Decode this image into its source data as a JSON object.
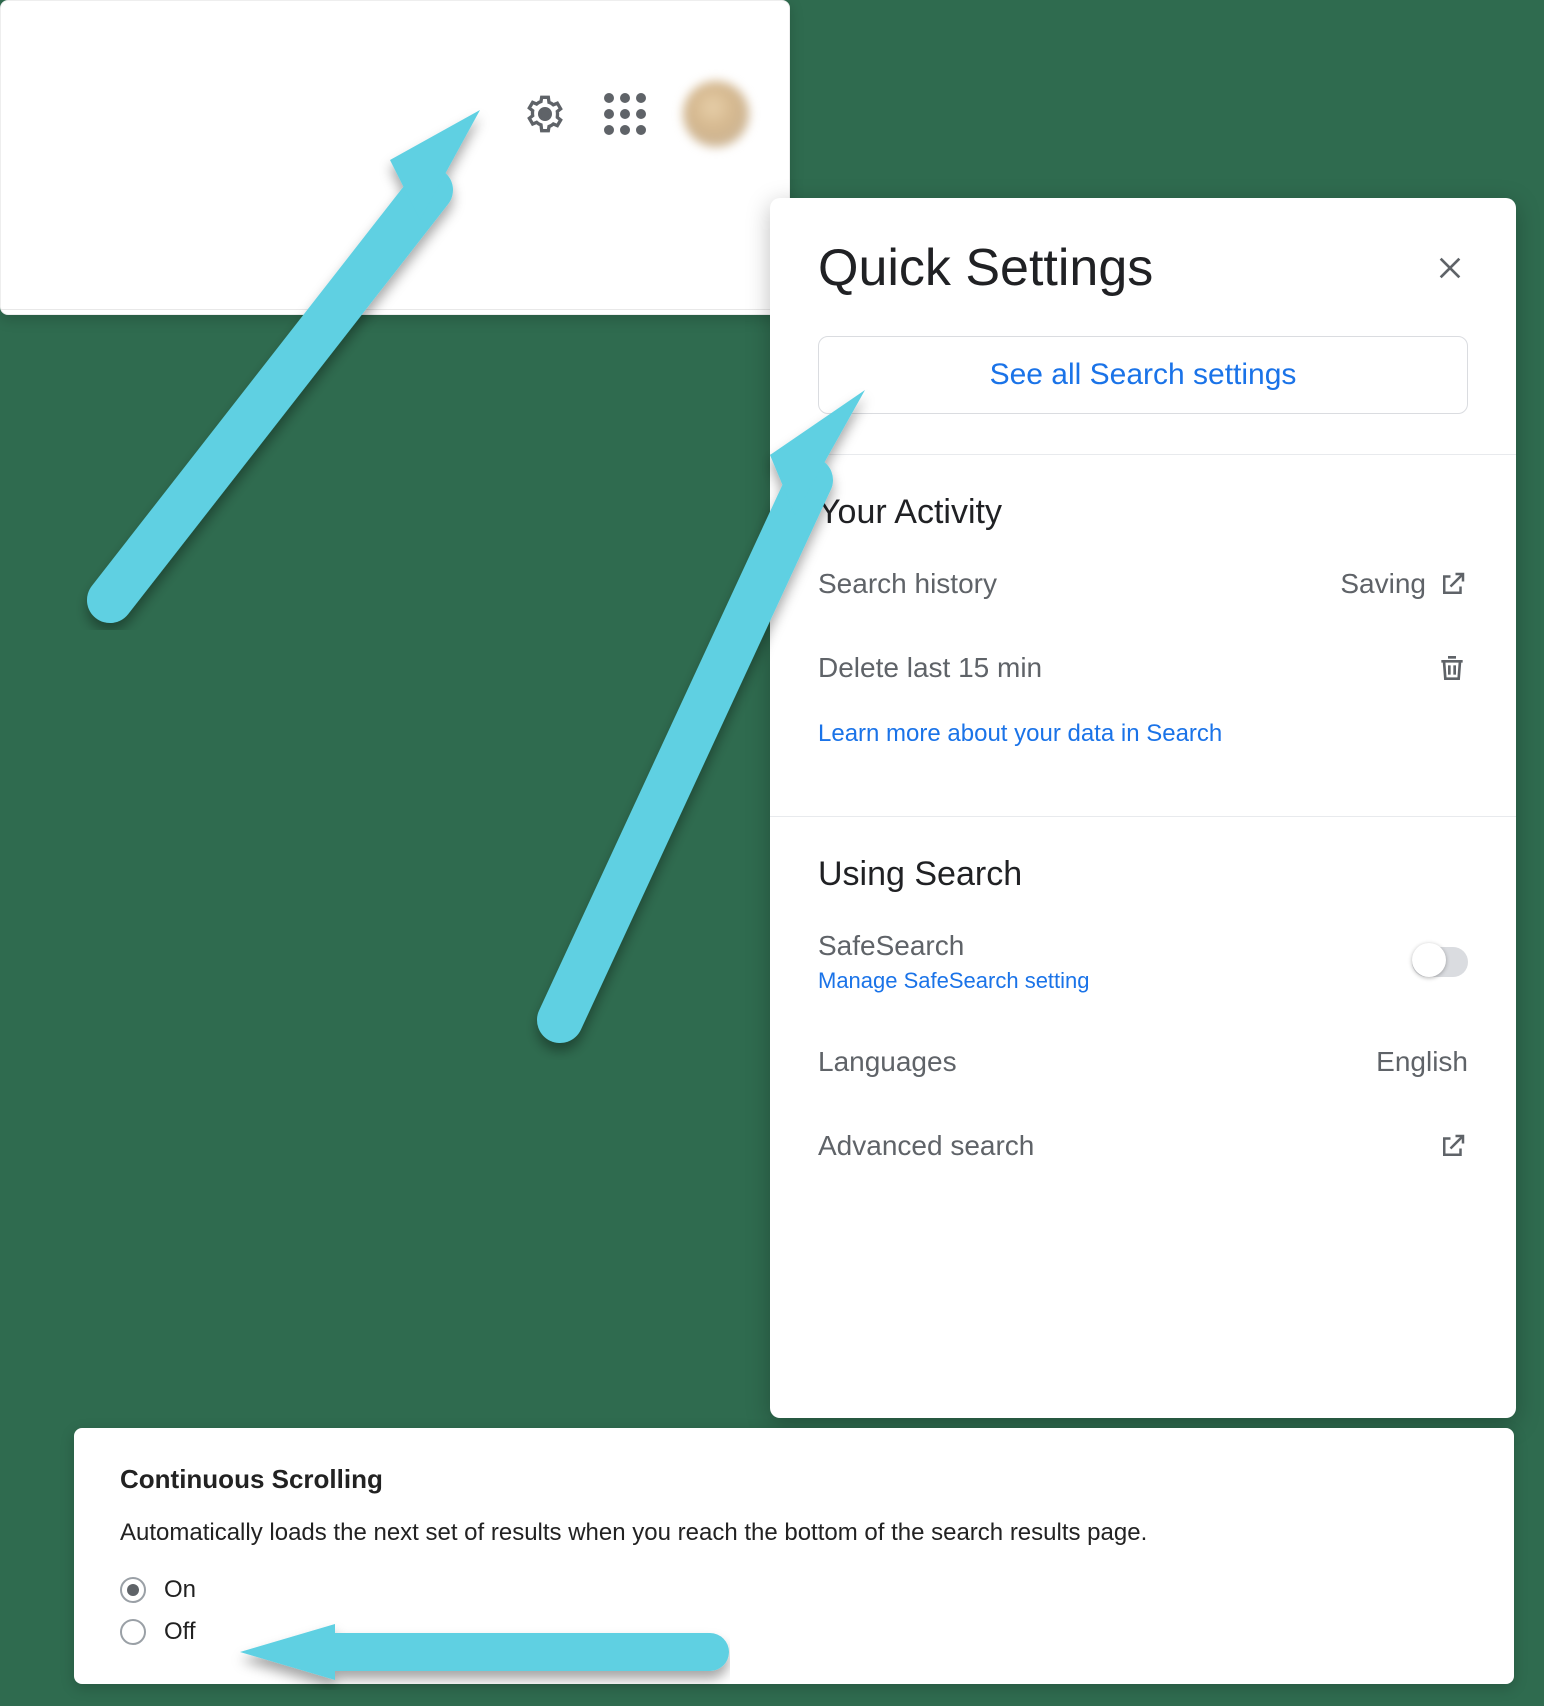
{
  "quick_settings": {
    "title": "Quick Settings",
    "see_all_label": "See all Search settings",
    "sections": {
      "activity": {
        "heading": "Your Activity",
        "search_history_label": "Search history",
        "search_history_value": "Saving",
        "delete_label": "Delete last 15 min",
        "learn_more": "Learn more about your data in Search"
      },
      "using": {
        "heading": "Using Search",
        "safesearch_label": "SafeSearch",
        "safesearch_manage": "Manage SafeSearch setting",
        "languages_label": "Languages",
        "languages_value": "English",
        "advanced_label": "Advanced search"
      }
    }
  },
  "continuous_scrolling": {
    "title": "Continuous Scrolling",
    "description": "Automatically loads the next set of results when you reach the bottom of the search results page.",
    "options": {
      "on": "On",
      "off": "Off"
    },
    "selected": "on"
  },
  "annotations": {
    "arrow_color": "#5ed0e2"
  }
}
